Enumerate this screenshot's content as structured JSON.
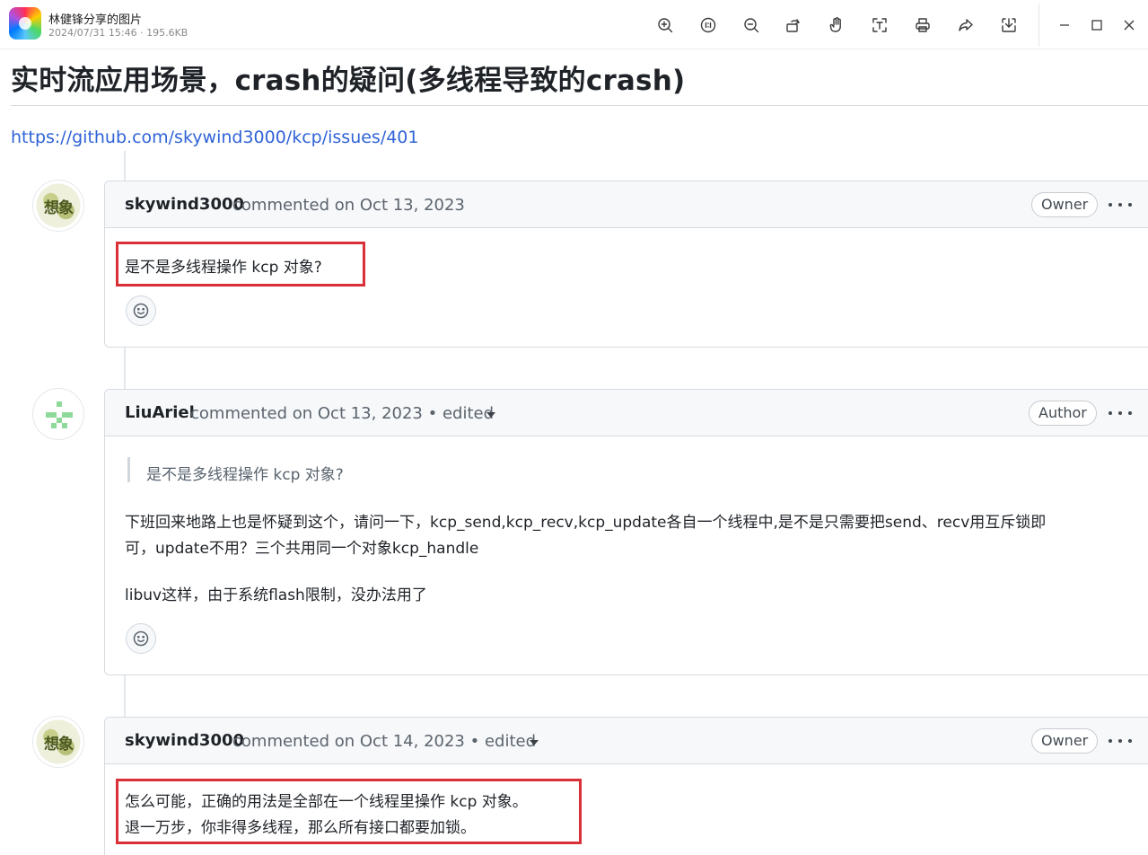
{
  "viewer": {
    "title": "林健锋分享的图片",
    "meta": "2024/07/31 15:46 · 195.6KB",
    "tools": [
      "zoom-in-icon",
      "actual-size-icon",
      "zoom-out-icon",
      "rotate-icon",
      "hand-pan-icon",
      "text-extract-icon",
      "print-icon",
      "share-icon",
      "download-icon"
    ]
  },
  "document": {
    "title": "实时流应用场景，crash的疑问(多线程导致的crash)",
    "link": "https://github.com/skywind3000/kcp/issues/401"
  },
  "comments": [
    {
      "author": "skywind3000",
      "meta": "commented on Oct 13, 2023",
      "role": "Owner",
      "lines": [
        "是不是多线程操作 kcp 对象?"
      ]
    },
    {
      "author": "LiuAriel",
      "meta": "commented on Oct 13, 2023 • edited",
      "role": "Author",
      "quote": "是不是多线程操作 kcp 对象?",
      "paragraph1_line1": "下班回来地路上也是怀疑到这个，请问一下，kcp_send,kcp_recv,kcp_update各自一个线程中,是不是只需要把send、recv用互斥锁即",
      "paragraph1_line2": "可，update不用？三个共用同一个对象kcp_handle",
      "paragraph2": "libuv这样，由于系统flash限制，没办法用了"
    },
    {
      "author": "skywind3000",
      "meta": "commented on Oct 14, 2023 • edited",
      "role": "Owner",
      "lines": [
        "怎么可能，正确的用法是全部在一个线程里操作 kcp 对象。",
        "退一万步，你非得多线程，那么所有接口都要加锁。"
      ]
    }
  ],
  "colors": {
    "link": "#2f63d6",
    "highlight_box": "#d93037",
    "header_bg": "#f6f8fa"
  }
}
